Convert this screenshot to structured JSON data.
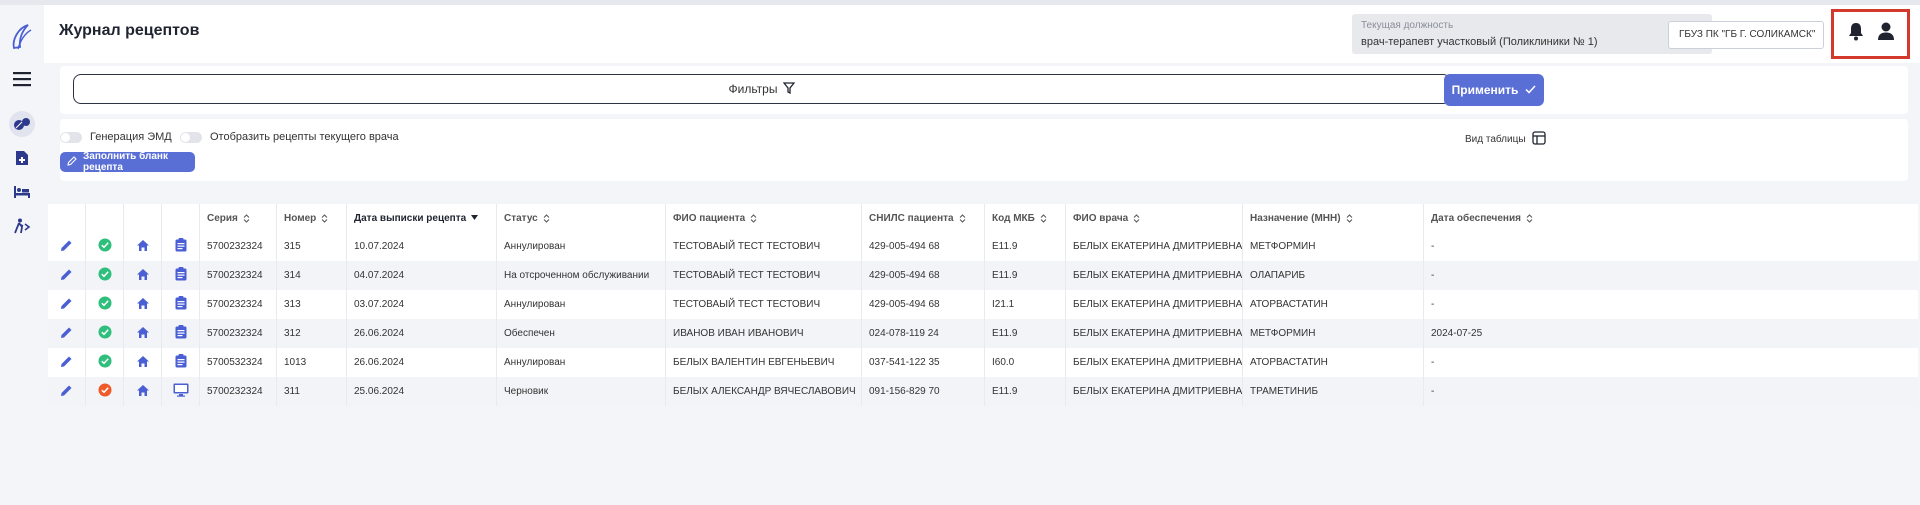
{
  "header": {
    "title": "Журнал рецептов",
    "position_label": "Текущая должность",
    "position_value": "врач-терапевт участковый (Поликлиники № 1)",
    "organization": "ГБУЗ ПК \"ГБ Г. СОЛИКАМСК\""
  },
  "filters": {
    "label": "Фильтры",
    "apply_label": "Применить"
  },
  "options": {
    "toggle_emd": "Генерация ЭМД",
    "toggle_current_doctor": "Отобразить рецепты текущего врача",
    "fill_blank_label": "Заполнить бланк рецепта",
    "view_table_label": "Вид таблицы"
  },
  "table": {
    "columns": [
      "Серия",
      "Номер",
      "Дата выписки рецепта",
      "Статус",
      "ФИО пациента",
      "СНИЛС пациента",
      "Код МКБ",
      "ФИО врача",
      "Назначение (МНН)",
      "Дата обеспечения"
    ],
    "sorted_column": "Дата выписки рецепта",
    "rows": [
      {
        "status_icon": "ok",
        "type_icon": "clipboard",
        "series": "5700232324",
        "number": "315",
        "date": "10.07.2024",
        "status": "Аннулирован",
        "patient": "ТЕСТОВАЫЙ ТЕСТ ТЕСТОВИЧ",
        "snils": "429-005-494 68",
        "mkb": "E11.9",
        "doctor": "БЕЛЫХ ЕКАТЕРИНА ДМИТРИЕВНА",
        "drug": "МЕТФОРМИН",
        "provision_date": "-"
      },
      {
        "status_icon": "ok",
        "type_icon": "clipboard",
        "series": "5700232324",
        "number": "314",
        "date": "04.07.2024",
        "status": "На отсроченном обслуживании",
        "patient": "ТЕСТОВАЫЙ ТЕСТ ТЕСТОВИЧ",
        "snils": "429-005-494 68",
        "mkb": "E11.9",
        "doctor": "БЕЛЫХ ЕКАТЕРИНА ДМИТРИЕВНА",
        "drug": "ОЛАПАРИБ",
        "provision_date": "-"
      },
      {
        "status_icon": "ok",
        "type_icon": "clipboard",
        "series": "5700232324",
        "number": "313",
        "date": "03.07.2024",
        "status": "Аннулирован",
        "patient": "ТЕСТОВАЫЙ ТЕСТ ТЕСТОВИЧ",
        "snils": "429-005-494 68",
        "mkb": "I21.1",
        "doctor": "БЕЛЫХ ЕКАТЕРИНА ДМИТРИЕВНА",
        "drug": "АТОРВАСТАТИН",
        "provision_date": "-"
      },
      {
        "status_icon": "ok",
        "type_icon": "clipboard",
        "series": "5700232324",
        "number": "312",
        "date": "26.06.2024",
        "status": "Обеспечен",
        "patient": "ИВАНОВ ИВАН ИВАНОВИЧ",
        "snils": "024-078-119 24",
        "mkb": "E11.9",
        "doctor": "БЕЛЫХ ЕКАТЕРИНА ДМИТРИЕВНА",
        "drug": "МЕТФОРМИН",
        "provision_date": "2024-07-25"
      },
      {
        "status_icon": "ok",
        "type_icon": "clipboard",
        "series": "5700532324",
        "number": "1013",
        "date": "26.06.2024",
        "status": "Аннулирован",
        "patient": "БЕЛЫХ ВАЛЕНТИН ЕВГЕНЬЕВИЧ",
        "snils": "037-541-122 35",
        "mkb": "I60.0",
        "doctor": "БЕЛЫХ ЕКАТЕРИНА ДМИТРИЕВНА",
        "drug": "АТОРВАСТАТИН",
        "provision_date": "-"
      },
      {
        "status_icon": "error",
        "type_icon": "monitor",
        "series": "5700232324",
        "number": "311",
        "date": "25.06.2024",
        "status": "Черновик",
        "patient": "БЕЛЫХ АЛЕКСАНДР ВЯЧЕСЛАВОВИЧ",
        "snils": "091-156-829 70",
        "mkb": "E11.9",
        "doctor": "БЕЛЫХ ЕКАТЕРИНА ДМИТРИЕВНА",
        "drug": "ТРАМЕТИНИБ",
        "provision_date": "-"
      }
    ]
  },
  "colors": {
    "accent": "#5a6fd6",
    "ok": "#2ebf7c",
    "error": "#f05a28",
    "icon": "#4a5fd4",
    "highlight": "#d33a2c"
  }
}
